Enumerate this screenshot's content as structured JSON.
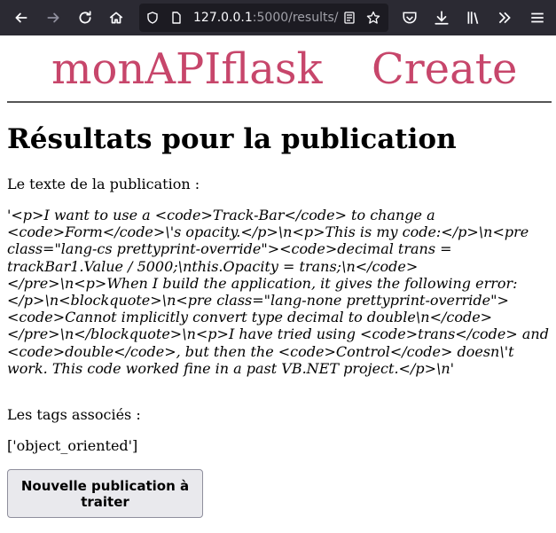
{
  "browser": {
    "url_host": "127.0.0.1",
    "url_rest": ":5000/results/",
    "icons": [
      "back-arrow-icon",
      "forward-arrow-icon",
      "reload-icon",
      "home-icon",
      "shield-icon",
      "page-icon",
      "reader-view-icon",
      "bookmark-star-icon",
      "pocket-icon",
      "download-icon",
      "library-icon",
      "overflow-chevrons-icon",
      "menu-icon"
    ]
  },
  "header": {
    "brand": "monAPIflask",
    "create_link": "Create"
  },
  "main": {
    "title": "Résultats pour la publication",
    "text_label": "Le texte de la publication :",
    "publication_text": "'<p>I want to use a <code>Track-Bar</code> to change a <code>Form</code>\\'s opacity.</p>\\n<p>This is my code:</p>\\n<pre class=\"lang-cs prettyprint-override\"><code>decimal trans = trackBar1.Value / 5000;\\nthis.Opacity = trans;\\n</code></pre>\\n<p>When I build the application, it gives the following error:</p>\\n<blockquote>\\n<pre class=\"lang-none prettyprint-override\"><code>Cannot implicitly convert type decimal to double\\n</code></pre>\\n</blockquote>\\n<p>I have tried using <code>trans</code> and <code>double</code>, but then the <code>Control</code> doesn\\'t work. This code worked fine in a past VB.NET project.</p>\\n'",
    "tags_label": "Les tags associés :",
    "tags_value": "['object_oriented']",
    "next_button": "Nouvelle publication à traiter"
  },
  "colors": {
    "toolbar_bg": "#2b2a33",
    "urlbar_bg": "#1c1b22",
    "brand": "#c7466b"
  }
}
